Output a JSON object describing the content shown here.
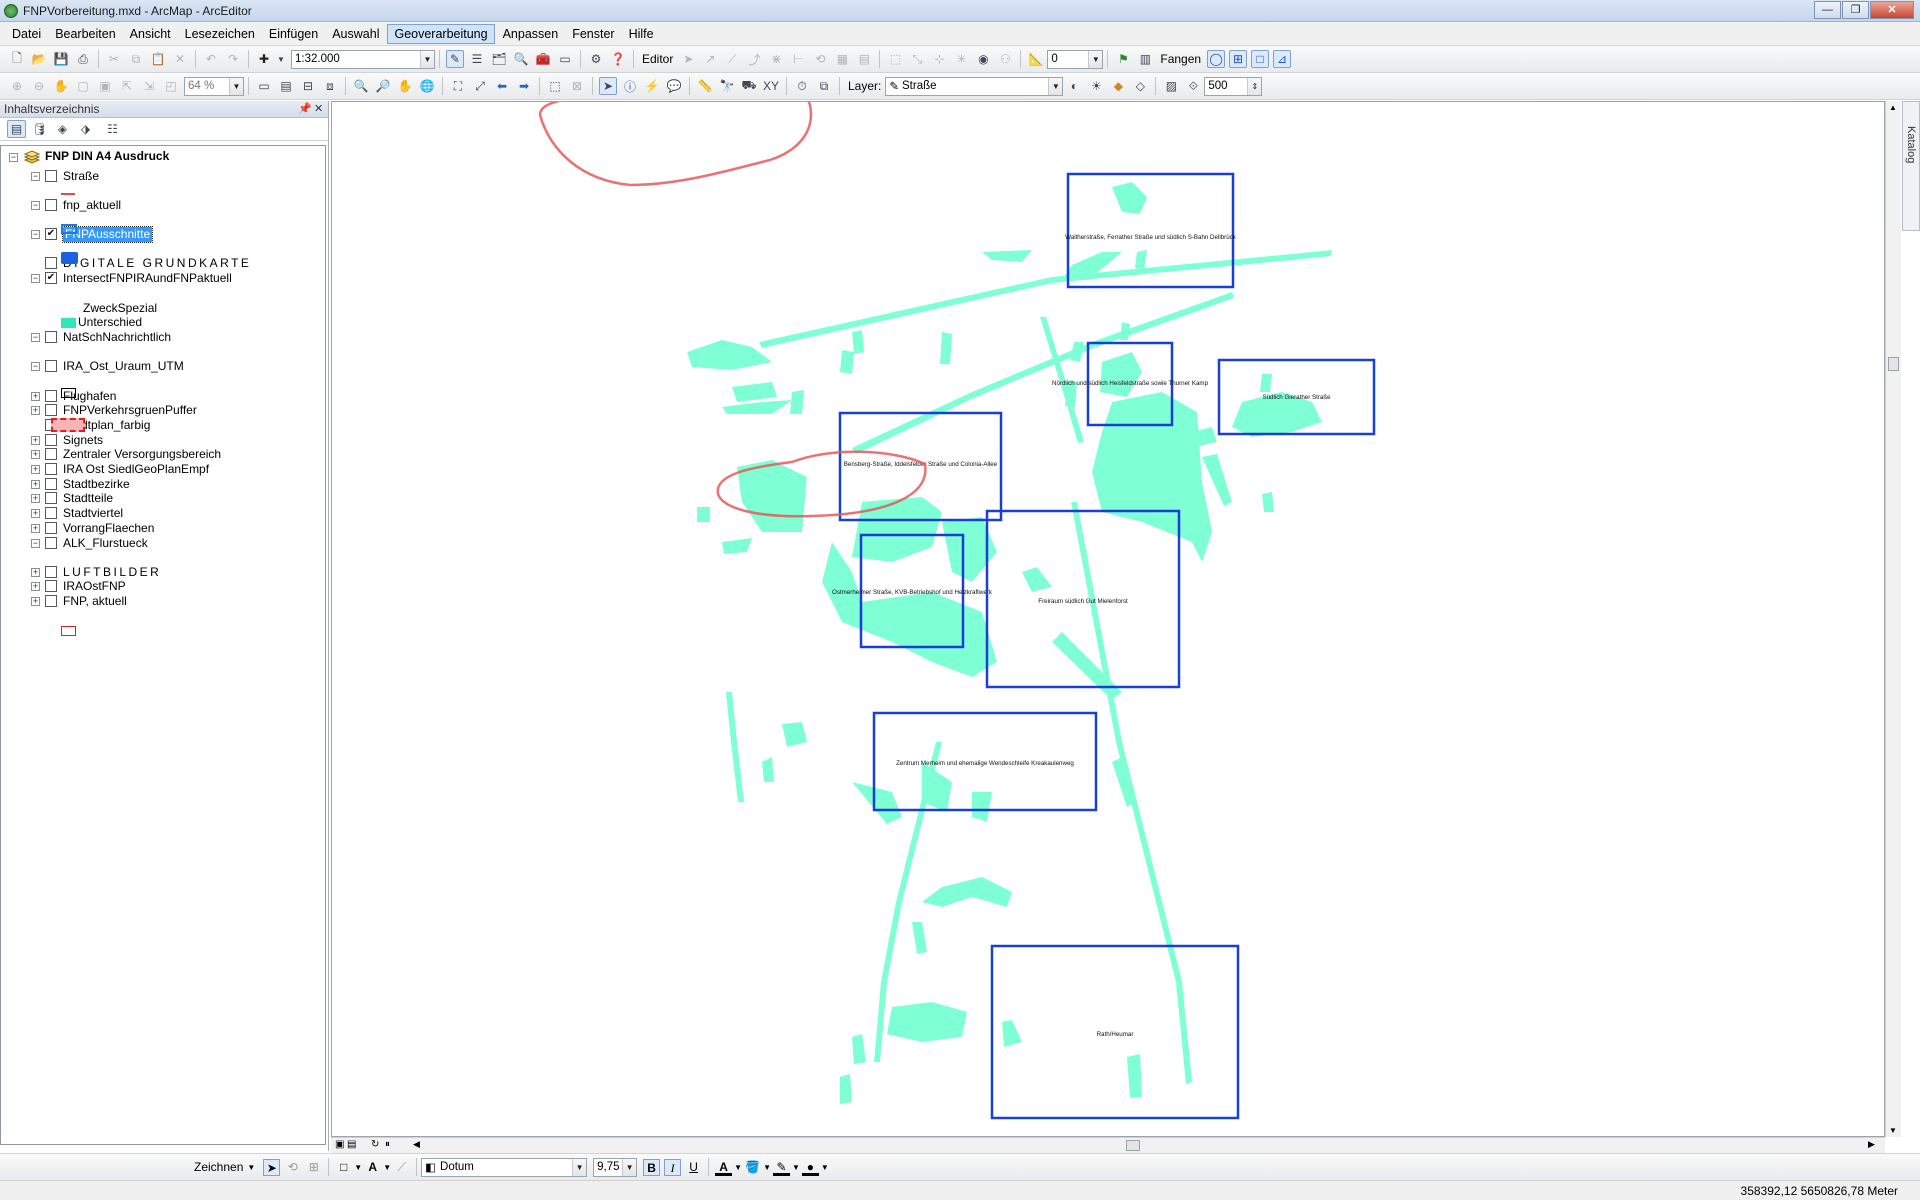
{
  "window": {
    "title": "FNPVorbereitung.mxd - ArcMap - ArcEditor"
  },
  "menu": [
    "Datei",
    "Bearbeiten",
    "Ansicht",
    "Lesezeichen",
    "Einfügen",
    "Auswahl",
    "Geoverarbeitung",
    "Anpassen",
    "Fenster",
    "Hilfe"
  ],
  "menu_active": "Geoverarbeitung",
  "toolbar": {
    "scale": "1:32.000",
    "zoom": "64 %",
    "editor_label": "Editor",
    "editor_value": "0",
    "snapping_label": "Fangen",
    "layer_label": "Layer:",
    "layer_value": "Straße",
    "tolerance": "500"
  },
  "toc": {
    "title": "Inhaltsverzeichnis",
    "dataframe": "FNP DIN A4 Ausdruck",
    "layers": [
      {
        "name": "Straße",
        "checked": false,
        "expanded": true
      },
      {
        "name": "fnp_aktuell",
        "checked": false,
        "expanded": true
      },
      {
        "name": "FNPAusschnitte",
        "checked": true,
        "expanded": true,
        "selected": true
      },
      {
        "name": "DIGITALE GRUNDKARTE",
        "checked": false,
        "expanded": null
      },
      {
        "name": "IntersectFNPIRAundFNPaktuell",
        "checked": true,
        "expanded": true
      },
      {
        "name": "NatSchNachrichtlich",
        "checked": false,
        "expanded": true
      },
      {
        "name": "IRA_Ost_Uraum_UTM",
        "checked": false,
        "expanded": true
      },
      {
        "name": "Flughafen",
        "checked": false,
        "expanded": false
      },
      {
        "name": "FNPVerkehrsgruenPuffer",
        "checked": false,
        "expanded": false
      },
      {
        "name": "Stadtplan_farbig",
        "checked": false,
        "expanded": null
      },
      {
        "name": "Signets",
        "checked": false,
        "expanded": false
      },
      {
        "name": "Zentraler Versorgungsbereich",
        "checked": false,
        "expanded": false
      },
      {
        "name": "IRA Ost SiedlGeoPlanEmpf",
        "checked": false,
        "expanded": false
      },
      {
        "name": "Stadtbezirke",
        "checked": false,
        "expanded": false
      },
      {
        "name": "Stadtteile",
        "checked": false,
        "expanded": false
      },
      {
        "name": "Stadtviertel",
        "checked": false,
        "expanded": false
      },
      {
        "name": "VorrangFlaechen",
        "checked": false,
        "expanded": false
      },
      {
        "name": "ALK_Flurstueck",
        "checked": false,
        "expanded": true
      },
      {
        "name": "LUFTBILDER",
        "checked": false,
        "expanded": false
      },
      {
        "name": "IRAOstFNP",
        "checked": false,
        "expanded": false
      },
      {
        "name": "FNP, aktuell",
        "checked": false,
        "expanded": false
      }
    ],
    "field_label": "ZweckSpezial",
    "class_label": "Unterschied"
  },
  "map": {
    "frame_labels": [
      "Waltherstraße, Ferrather Straße und südlich S-Bahn Dellbrück",
      "Nördlich und südlich Heisfeldstraße sowie Thurner Kamp",
      "Südlich Gierather Straße",
      "Bensberg-Straße, Iddelsfelder Straße und Colonia-Allee",
      "Ostmerheimer Straße, KVB-Betriebshof und Heizkraftwerk",
      "Freiraum südlich Gut Mielenforst",
      "Zentrum Merheim und ehemalige Wendeschleife Kreakaulenweg",
      "Rath/Heumar"
    ],
    "colors": {
      "frame": "#1a3fd6",
      "feature": "#7fffd4",
      "annotation": "#e8585a"
    }
  },
  "catalog": {
    "label": "Katalog"
  },
  "drawing": {
    "zeichnen": "Zeichnen",
    "font": "Dotum",
    "size": "9,75",
    "bold": "B",
    "italic": "I",
    "underline": "U"
  },
  "status": {
    "coords": "358392,12  5650826,78 Meter"
  }
}
